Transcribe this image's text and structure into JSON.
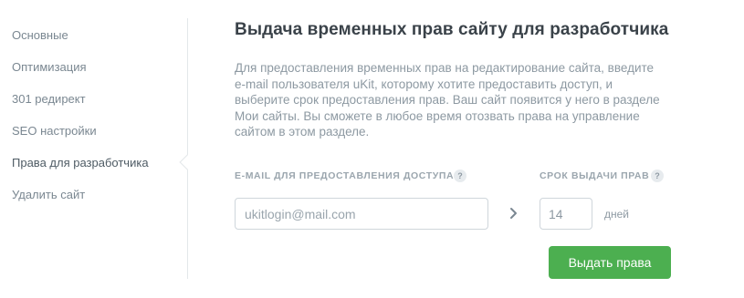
{
  "sidebar": {
    "items": [
      {
        "label": "Основные"
      },
      {
        "label": "Оптимизация"
      },
      {
        "label": "301 редирект"
      },
      {
        "label": "SEO настройки"
      },
      {
        "label": "Права для разработчика"
      },
      {
        "label": "Удалить сайт"
      }
    ],
    "active_item": "Права для разработчика"
  },
  "main": {
    "title": "Выдача временных прав сайту для разработчика",
    "description": "Для предоставления временных прав на редактирование сайта, введите e-mail пользователя uKit, которому хотите предоставить доступ, и выберите срок предоставления прав. Ваш сайт появится у него в разделе Мои сайты. Вы сможете в любое время отозвать права на управление сайтом в этом разделе.",
    "email_field": {
      "label": "E-MAIL ДЛЯ ПРЕДОСТАВЛЕНИЯ ДОСТУПА",
      "help": "?",
      "placeholder": "ukitlogin@mail.com",
      "value": ""
    },
    "term_field": {
      "label": "СРОК ВЫДАЧИ ПРАВ",
      "help": "?",
      "value": "14",
      "unit": "дней"
    },
    "submit_label": "Выдать права"
  },
  "colors": {
    "accent_green": "#4caf50",
    "text_muted": "#8d99a2",
    "heading": "#3a4249"
  },
  "icons": {
    "chevron": "chevron-right-icon",
    "help": "question-icon"
  }
}
